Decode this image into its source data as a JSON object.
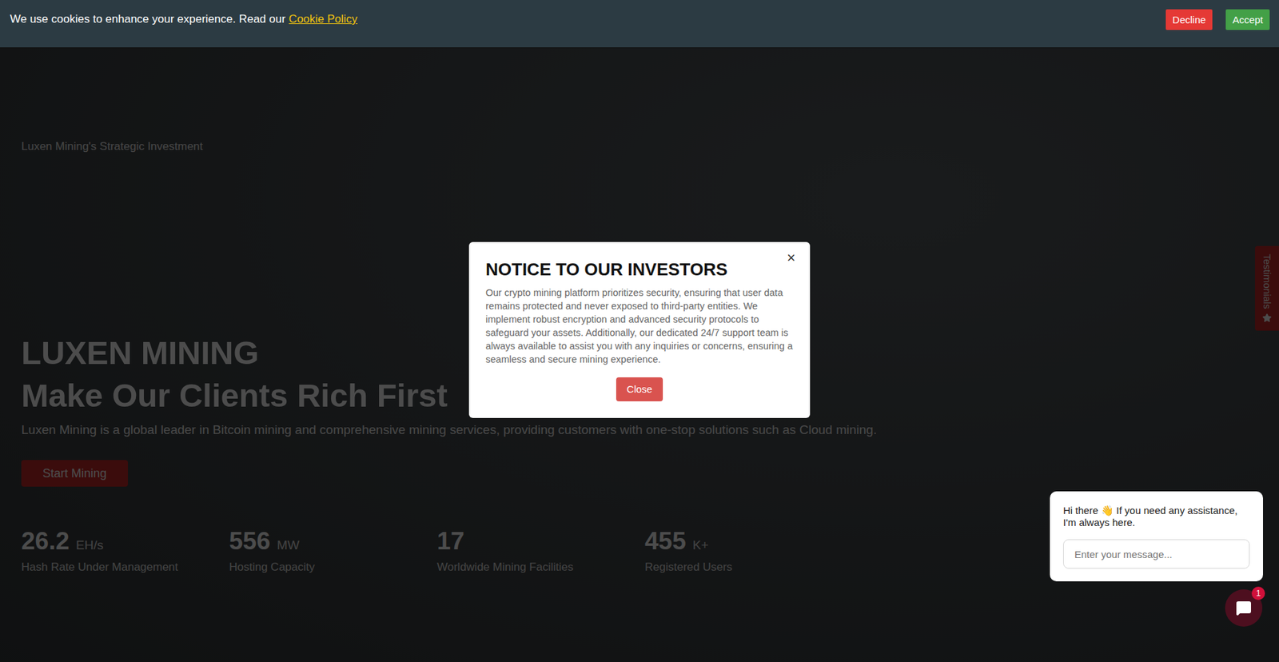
{
  "cookie_bar": {
    "text": "We use cookies to enhance your experience. Read our",
    "link": "Cookie Policy",
    "buttons": [
      {
        "label": "Decline",
        "kind": "decline"
      },
      {
        "label": "Accept",
        "kind": "accept"
      }
    ]
  },
  "hero": {
    "tagline": "Luxen Mining's Strategic Investment",
    "title": "LUXEN MINING",
    "headline": "Make Our Clients Rich First",
    "description": "Luxen Mining is a global leader in Bitcoin mining and comprehensive mining services, providing customers with one-stop solutions such as Cloud mining.",
    "button": "Start Mining",
    "stats": [
      {
        "value": "26.2",
        "unit": "EH/s",
        "label": "Hash Rate Under Management"
      },
      {
        "value": "556",
        "unit": "MW",
        "label": "Hosting Capacity"
      },
      {
        "value": "17",
        "unit": "",
        "label": "Worldwide Mining Facilities"
      },
      {
        "value": "455",
        "unit": "K+",
        "label": "Registered Users"
      }
    ]
  },
  "side_tab": {
    "label": "Testimonials"
  },
  "modal": {
    "title": "NOTICE TO OUR INVESTORS",
    "body": "Our crypto mining platform prioritizes security, ensuring that user data remains protected and never exposed to third-party entities. We implement robust encryption and advanced security protocols to safeguard your assets. Additionally, our dedicated 24/7 support team is always available to assist you with any inquiries or concerns, ensuring a seamless and secure mining experience.",
    "close_icon": "×",
    "button": "Close"
  },
  "chat": {
    "greeting": "Hi there 👋 If you need any assistance, I'm always here.",
    "placeholder": "Enter your message...",
    "badge": "1"
  }
}
